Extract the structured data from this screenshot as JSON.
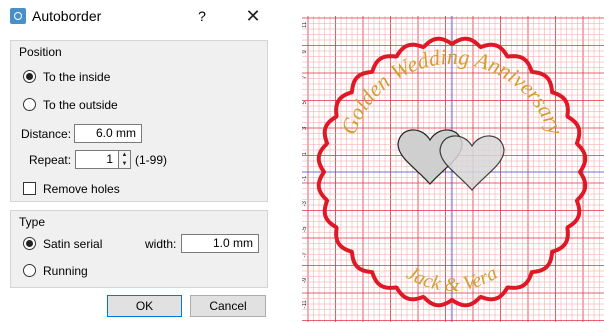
{
  "dialog": {
    "title": "Autoborder",
    "help_label": "?",
    "close_label": "✕",
    "position_group": {
      "title": "Position",
      "radio_inside": "To the inside",
      "radio_outside": "To the outside",
      "selected": "To the inside",
      "distance_label": "Distance:",
      "distance_value": "6.0 mm",
      "repeat_label": "Repeat:",
      "repeat_value": "1",
      "repeat_range": "(1-99)",
      "remove_holes_label": "Remove holes",
      "remove_holes_checked": false
    },
    "type_group": {
      "title": "Type",
      "radio_satin": "Satin serial",
      "radio_running": "Running",
      "selected": "Satin serial",
      "width_label": "width:",
      "width_value": "1.0 mm"
    },
    "ok_label": "OK",
    "cancel_label": "Cancel"
  },
  "canvas": {
    "arc_text_top": "Golden Wedding Anniversary",
    "arc_text_bottom": "Jack & Vera",
    "ruler_labels": [
      "11",
      "9",
      "7",
      "5",
      "3",
      "1",
      "-1",
      "-3",
      "-5",
      "-7",
      "-9",
      "-11"
    ],
    "colors": {
      "grid_minor": "#f4a0a4",
      "grid_major": "#e03040",
      "axis": "#3a58d8",
      "border": "#e01826",
      "text": "#d0a030",
      "hearts_fill": "#cfcfcf"
    }
  }
}
